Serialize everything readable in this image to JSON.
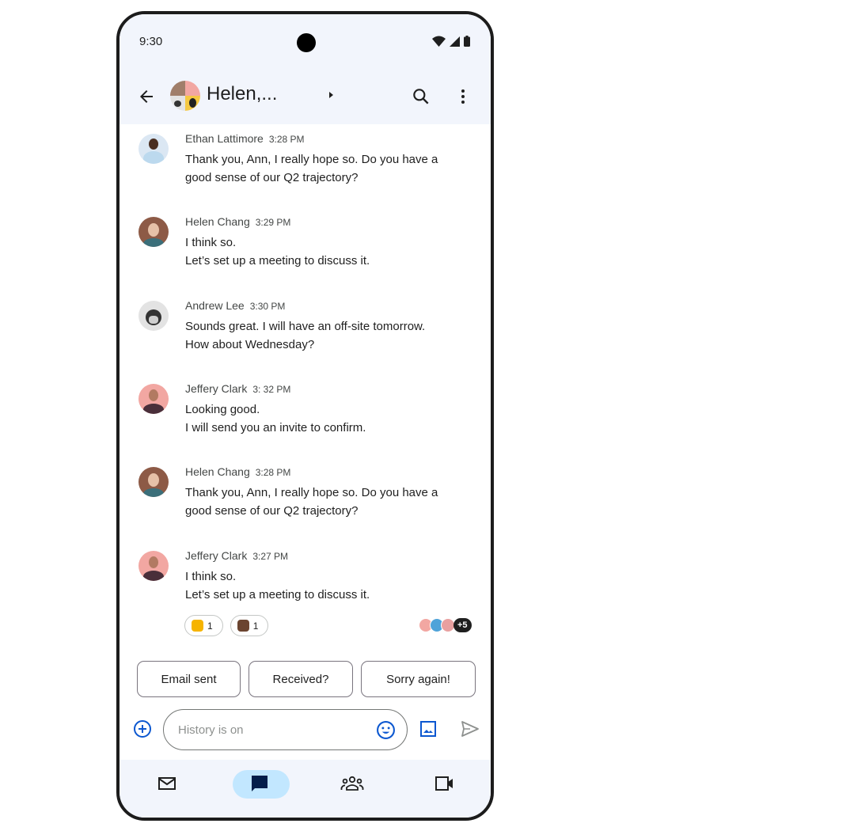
{
  "status_bar": {
    "time": "9:30",
    "icons": [
      "wifi-icon",
      "signal-icon",
      "battery-icon"
    ]
  },
  "app_bar": {
    "back_icon": "arrow-left-icon",
    "title": "Helen,...",
    "search_icon": "search-icon",
    "more_icon": "more-vert-icon"
  },
  "messages": [
    {
      "sender": "Ethan Lattimore",
      "time": "3:28 PM",
      "text": "Thank you, Ann, I really hope so. Do you have a\ngood sense of our Q2 trajectory?",
      "avatar_color": "#dbe7f3"
    },
    {
      "sender": "Helen Chang",
      "time": "3:29 PM",
      "text": "I think so.\nLet’s set up a meeting to discuss it.",
      "avatar_color": "#8d5a46"
    },
    {
      "sender": "Andrew Lee",
      "time": "3:30 PM",
      "text": "Sounds great. I will have an off-site tomorrow.\nHow about Wednesday?",
      "avatar_color": "#e3e3e3"
    },
    {
      "sender": "Jeffery Clark",
      "time": "3: 32 PM",
      "text": "Looking good.\nI will send you an invite to confirm.",
      "avatar_color": "#f2a7a2"
    },
    {
      "sender": "Helen Chang",
      "time": "3:28 PM",
      "text": "Thank you, Ann, I really hope so. Do you have a\ngood sense of our Q2 trajectory?",
      "avatar_color": "#8d5a46"
    },
    {
      "sender": "Jeffery Clark",
      "time": "3:27 PM",
      "text": "I think so.\nLet’s set up a meeting to discuss it.",
      "avatar_color": "#f2a7a2"
    }
  ],
  "reactions": [
    {
      "emoji": "thumbs-up",
      "count": "1",
      "color": "#f6b400"
    },
    {
      "emoji": "clapping-hands",
      "count": "1",
      "color": "#6b4430"
    }
  ],
  "seen_by": {
    "avatar_colors": [
      "#f2a7a2",
      "#4fa3d9",
      "#e8a0a0"
    ],
    "more_label": "+5"
  },
  "smart_replies": [
    "Email sent",
    "Received?",
    "Sorry again!"
  ],
  "composer": {
    "placeholder": "History is on",
    "value": "",
    "add_icon": "add-circle-icon",
    "emoji_icon": "emoji-icon",
    "image_icon": "image-icon",
    "send_icon": "send-icon"
  },
  "bottom_nav": [
    {
      "id": "mail",
      "icon": "mail-icon",
      "active": false
    },
    {
      "id": "chat",
      "icon": "chat-icon",
      "active": true
    },
    {
      "id": "spaces",
      "icon": "group-icon",
      "active": false
    },
    {
      "id": "meet",
      "icon": "video-icon",
      "active": false
    }
  ],
  "colors": {
    "surface": "#f2f5fc",
    "accent": "#0b57d0",
    "active_pill": "#c2e7ff",
    "text": "#1f1f1f"
  }
}
